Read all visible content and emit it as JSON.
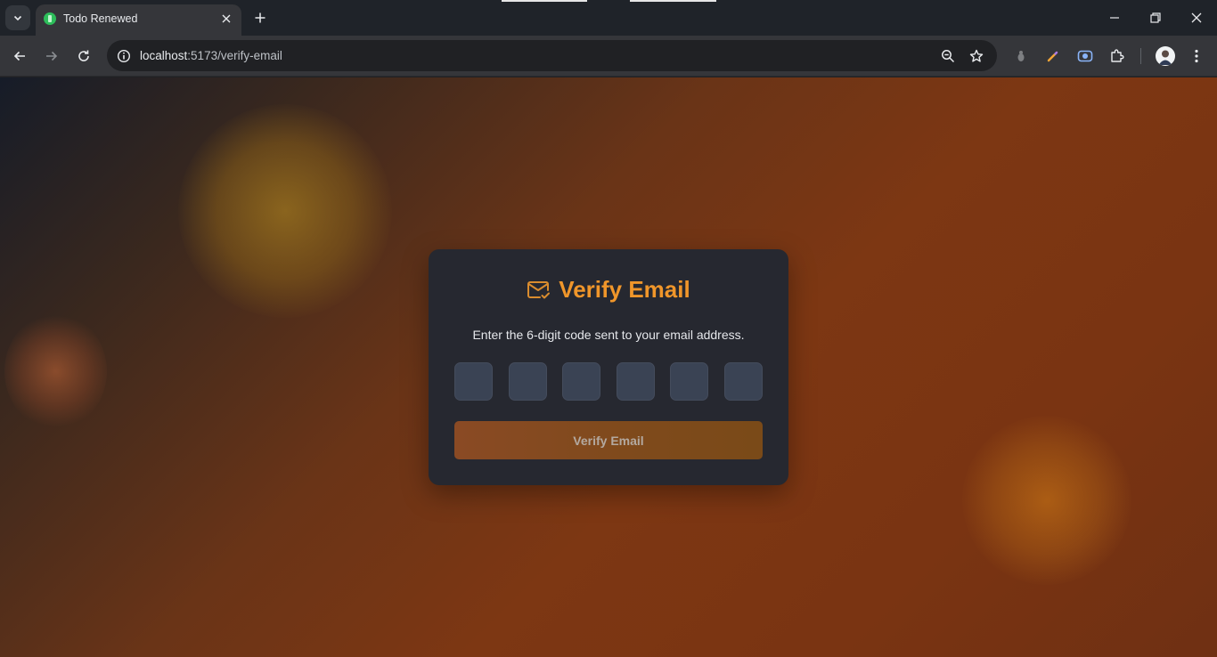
{
  "browser": {
    "tab": {
      "title": "Todo Renewed"
    },
    "address": {
      "host": "localhost",
      "path": ":5173/verify-email"
    },
    "icons": [
      "tab-search-icon",
      "close-icon",
      "new-tab-icon",
      "minimize-icon",
      "restore-icon",
      "window-close-icon",
      "back-icon",
      "forward-icon",
      "reload-icon",
      "site-info-icon",
      "zoom-icon",
      "bookmark-star-icon",
      "extension-icon",
      "pen-icon",
      "camera-icon",
      "puzzle-icon",
      "profile-avatar",
      "kebab-menu-icon"
    ]
  },
  "page": {
    "title": "Verify Email",
    "subtitle": "Enter the 6-digit code sent to your email address.",
    "code_digits": [
      "",
      "",
      "",
      "",
      "",
      ""
    ],
    "submit_label": "Verify Email",
    "colors": {
      "accent": "#f0962a",
      "card": "#262830",
      "input": "#3a4354",
      "button": "#8a4a24"
    }
  }
}
